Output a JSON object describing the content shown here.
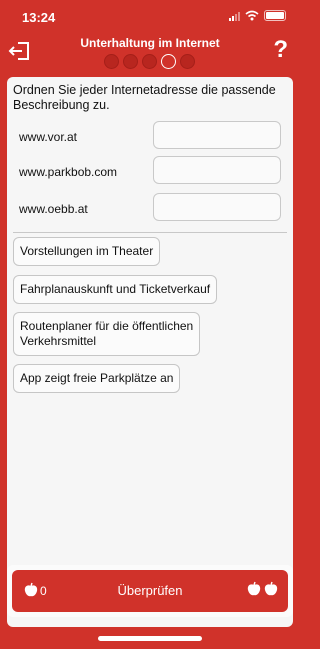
{
  "status": {
    "time": "13:24"
  },
  "header": {
    "title": "Unterhaltung im Internet",
    "help_label": "?",
    "progress": {
      "total": 4,
      "current": 4
    }
  },
  "exercise": {
    "instruction": "Ordnen Sie jeder Internetadresse die passende Beschreibung zu.",
    "targets": [
      {
        "label": "www.vor.at"
      },
      {
        "label": "www.parkbob.com"
      },
      {
        "label": "www.oebb.at"
      }
    ],
    "options": [
      {
        "label": "Vorstellungen im Theater"
      },
      {
        "label": "Fahrplanauskunft und Ticketverkauf"
      },
      {
        "label": "Routenplaner für die öffentlichen\nVerkehrsmittel"
      },
      {
        "label": "App zeigt freie Parkplätze an"
      }
    ]
  },
  "footer": {
    "apple_count": "0",
    "check_label": "Überprüfen"
  },
  "colors": {
    "brand_red": "#d0322a",
    "card_bg": "#f6f6f6"
  }
}
